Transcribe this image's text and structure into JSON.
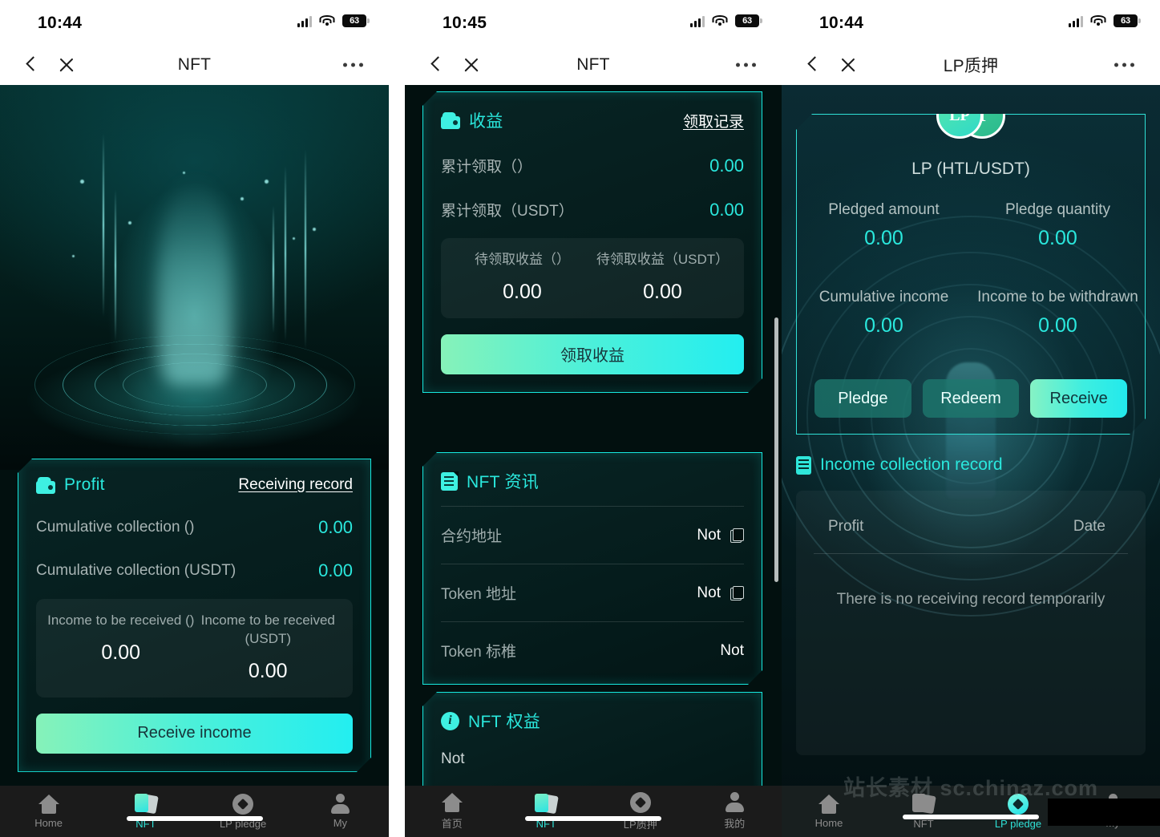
{
  "accent": "#2ae8dd",
  "phones": [
    {
      "status": {
        "time": "10:44",
        "battery": "63"
      },
      "nav": {
        "title": "NFT",
        "back_icon": "chevron-left-icon",
        "close_icon": "close-icon",
        "more_icon": "more-dots-icon"
      },
      "profit_card": {
        "icon": "wallet-icon",
        "title": "Profit",
        "link": "Receiving record",
        "rows": [
          {
            "label": "Cumulative collection ()",
            "value": "0.00"
          },
          {
            "label": "Cumulative collection (USDT)",
            "value": "0.00"
          }
        ],
        "pending": [
          {
            "label": "Income to be received ()",
            "value": "0.00"
          },
          {
            "label": "Income to be received (USDT)",
            "value": "0.00"
          }
        ],
        "cta": "Receive income"
      },
      "tabs": [
        {
          "label": "Home",
          "icon": "home-icon",
          "active": false
        },
        {
          "label": "NFT",
          "icon": "nft-cards-icon",
          "active": true
        },
        {
          "label": "LP pledge",
          "icon": "lp-diamond-icon",
          "active": false
        },
        {
          "label": "My",
          "icon": "person-icon",
          "active": false
        }
      ]
    },
    {
      "status": {
        "time": "10:45",
        "battery": "63"
      },
      "nav": {
        "title": "NFT",
        "back_icon": "chevron-left-icon",
        "close_icon": "close-icon",
        "more_icon": "more-dots-icon"
      },
      "income_card": {
        "icon": "wallet-icon",
        "title": "收益",
        "link": "领取记录",
        "rows": [
          {
            "label": "累计领取（）",
            "value": "0.00"
          },
          {
            "label": "累计领取（USDT）",
            "value": "0.00"
          }
        ],
        "pending": [
          {
            "label": "待领取收益（）",
            "value": "0.00"
          },
          {
            "label": "待领取收益（USDT）",
            "value": "0.00"
          }
        ],
        "cta": "领取收益"
      },
      "info_card": {
        "icon": "document-icon",
        "title": "NFT 资讯",
        "rows": [
          {
            "label": "合约地址",
            "value": "Not",
            "copy": true
          },
          {
            "label": "Token 地址",
            "value": "Not",
            "copy": true
          },
          {
            "label": "Token 标椎",
            "value": "Not",
            "copy": false
          }
        ]
      },
      "rights_card": {
        "icon": "info-icon",
        "title": "NFT 权益",
        "body": "Not"
      },
      "tabs": [
        {
          "label": "首页",
          "icon": "home-icon",
          "active": false
        },
        {
          "label": "NFT",
          "icon": "nft-cards-icon",
          "active": true
        },
        {
          "label": "LP质押",
          "icon": "lp-diamond-icon",
          "active": false
        },
        {
          "label": "我的",
          "icon": "person-icon",
          "active": false
        }
      ]
    },
    {
      "status": {
        "time": "10:44",
        "battery": "63"
      },
      "nav": {
        "title": "LP质押",
        "back_icon": "chevron-left-icon",
        "close_icon": "close-icon",
        "more_icon": "more-dots-icon"
      },
      "lp_card": {
        "logo_left": "LP",
        "logo_right": "T",
        "pair": "LP (HTL/USDT)",
        "stats": [
          {
            "label": "Pledged amount",
            "value": "0.00"
          },
          {
            "label": "Pledge quantity",
            "value": "0.00"
          },
          {
            "label": "Cumulative income",
            "value": "0.00"
          },
          {
            "label": "Income to be withdrawn",
            "value": "0.00"
          }
        ],
        "buttons": [
          {
            "label": "Pledge",
            "primary": false
          },
          {
            "label": "Redeem",
            "primary": false
          },
          {
            "label": "Receive",
            "primary": true
          }
        ]
      },
      "record": {
        "icon": "list-icon",
        "title": "Income collection record",
        "columns": [
          "Profit",
          "Date"
        ],
        "empty": "There is no receiving record temporarily"
      },
      "watermark": "站长素材 sc.chinaz.com",
      "tabs": [
        {
          "label": "Home",
          "icon": "home-icon",
          "active": false
        },
        {
          "label": "NFT",
          "icon": "nft-cards-icon",
          "active": false
        },
        {
          "label": "LP pledge",
          "icon": "lp-diamond-icon",
          "active": true
        },
        {
          "label": "My",
          "icon": "person-icon",
          "active": false
        }
      ]
    }
  ]
}
